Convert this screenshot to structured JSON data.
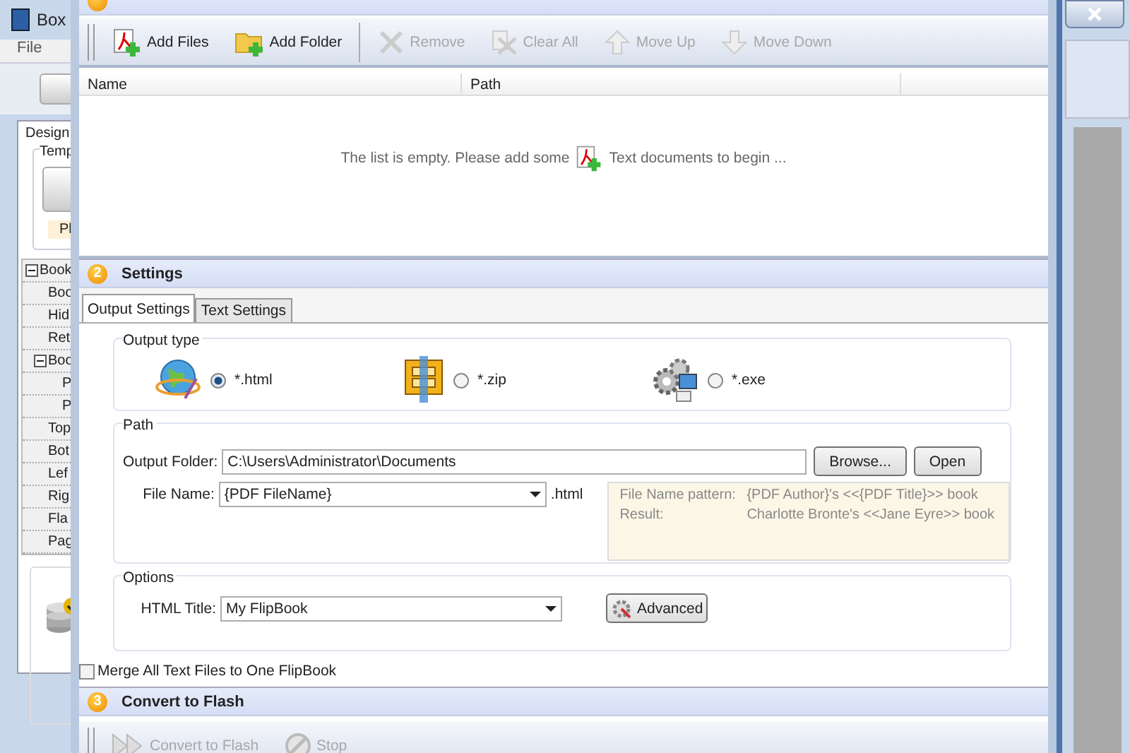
{
  "background_window": {
    "title": "Box",
    "menu": [
      "File"
    ],
    "tab": "Design",
    "group_label": "Temp",
    "note": "Pl",
    "tree": [
      {
        "label": "Book",
        "expanded": true,
        "children": [
          {
            "label": "Boo"
          },
          {
            "label": "Hid"
          },
          {
            "label": "Ret"
          },
          {
            "label": "Boo",
            "expanded": true,
            "children": [
              {
                "label": "P"
              },
              {
                "label": "P"
              }
            ]
          },
          {
            "label": "Top"
          },
          {
            "label": "Bot"
          },
          {
            "label": "Lef"
          },
          {
            "label": "Rig"
          },
          {
            "label": "Fla"
          },
          {
            "label": "Pag"
          }
        ]
      }
    ]
  },
  "dialog": {
    "section_1": {
      "toolbar": [
        {
          "label": "Add Files",
          "kind": "add-file",
          "disabled": false
        },
        {
          "label": "Add Folder",
          "kind": "add-folder",
          "disabled": false
        },
        {
          "label": "Remove",
          "kind": "remove",
          "disabled": true
        },
        {
          "label": "Clear All",
          "kind": "clear",
          "disabled": true
        },
        {
          "label": "Move Up",
          "kind": "up",
          "disabled": true
        },
        {
          "label": "Move Down",
          "kind": "down",
          "disabled": true
        }
      ],
      "table": {
        "columns": [
          "Name",
          "Path"
        ],
        "empty_before": "The list is empty. Please add some",
        "empty_after": "Text documents to begin ..."
      }
    },
    "section_2": {
      "number": "2",
      "title": "Settings",
      "tabs": [
        {
          "label": "Output Settings",
          "selected": true
        },
        {
          "label": "Text Settings",
          "selected": false
        }
      ],
      "output_type": {
        "label": "Output type",
        "options": [
          {
            "label": "*.html",
            "kind": "html",
            "selected": true
          },
          {
            "label": "*.zip",
            "kind": "zip",
            "selected": false
          },
          {
            "label": "*.exe",
            "kind": "exe",
            "selected": false
          }
        ]
      },
      "path": {
        "label": "Path",
        "output_folder_label": "Output Folder:",
        "output_folder": "C:\\Users\\Administrator\\Documents",
        "browse": "Browse...",
        "open": "Open",
        "file_name_label": "File Name:",
        "file_name": "{PDF FileName}",
        "extension": ".html",
        "hint": [
          {
            "label": "File Name pattern:",
            "value": "{PDF Author}'s <<{PDF Title}>> book"
          },
          {
            "label": "Result:",
            "value": "Charlotte Bronte's <<Jane Eyre>> book"
          }
        ]
      },
      "options": {
        "label": "Options",
        "html_title_label": "HTML Title:",
        "html_title": "My FlipBook",
        "advanced": "Advanced"
      },
      "merge": {
        "label": "Merge All Text Files to One FlipBook",
        "checked": false
      }
    },
    "section_3": {
      "number": "3",
      "title": "Convert to Flash",
      "toolbar": [
        {
          "label": "Convert to Flash",
          "kind": "convert",
          "disabled": true
        },
        {
          "label": "Stop",
          "kind": "stop",
          "disabled": true
        }
      ]
    }
  }
}
